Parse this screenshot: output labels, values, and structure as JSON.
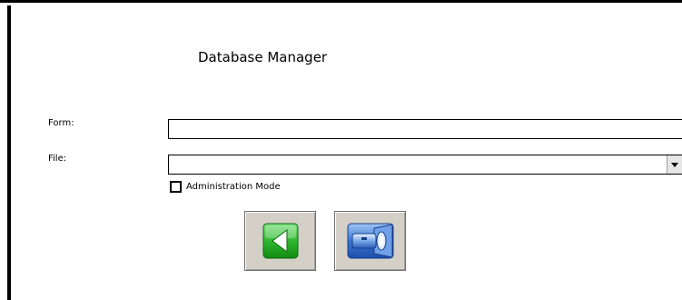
{
  "window": {
    "title": "Database Manager"
  },
  "form": {
    "form_label": "Form:",
    "form_value": "",
    "file_label": "File:",
    "file_value": "",
    "admin_mode_label": "Administration Mode",
    "admin_mode_checked": false
  },
  "buttons": {
    "back_icon": "green-back-arrow-icon",
    "search_icon": "flashlight-search-icon"
  },
  "colors": {
    "back_green": "#3fb93f",
    "search_blue": "#3b77d3",
    "button_face": "#d4d0c8"
  }
}
